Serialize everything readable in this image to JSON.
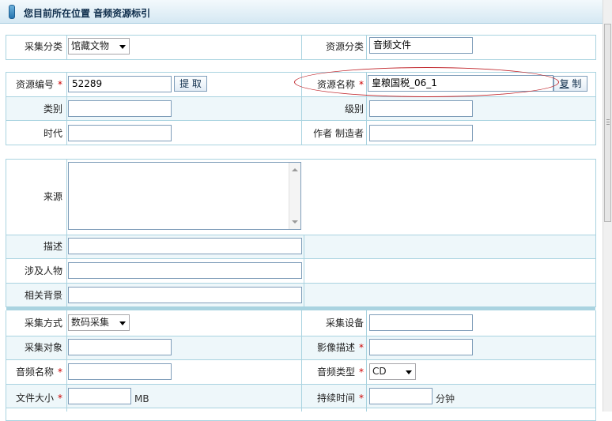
{
  "header": {
    "title": "您目前所在位置 音频资源标引"
  },
  "basic": {
    "collect_category_label": "采集分类",
    "collect_category_value": "馆藏文物",
    "resource_category_label": "资源分类",
    "resource_category_value": "音频文件"
  },
  "resource": {
    "id_label": "资源编号",
    "id_value": "52289",
    "fetch_button": "提 取",
    "name_label": "资源名称",
    "name_value": "皇粮国税_06_1",
    "copy_button_hotkey": "复",
    "copy_button_rest": " 制",
    "type_label": "类别",
    "type_value": "",
    "level_label": "级别",
    "level_value": "",
    "era_label": "时代",
    "era_value": "",
    "author_label": "作者 制造者",
    "author_value": ""
  },
  "details": {
    "source_label": "来源",
    "source_value": "",
    "description_label": "描述",
    "description_value": "",
    "persons_label": "涉及人物",
    "persons_value": "",
    "background_label": "相关背景",
    "background_value": ""
  },
  "collection": {
    "method_label": "采集方式",
    "method_value": "数码采集",
    "device_label": "采集设备",
    "device_value": "",
    "object_label": "采集对象",
    "object_value": "",
    "image_desc_label": "影像描述",
    "image_desc_value": "",
    "audio_name_label": "音频名称",
    "audio_name_value": "",
    "audio_type_label": "音频类型",
    "audio_type_value": "CD",
    "file_size_label": "文件大小",
    "file_size_value": "",
    "file_size_unit": "MB",
    "duration_label": "持续时间",
    "duration_value": "",
    "duration_unit": "分钟"
  },
  "colors": {
    "border": "#a9d3e0",
    "required": "#cc0000",
    "annotation": "#c0262c"
  }
}
